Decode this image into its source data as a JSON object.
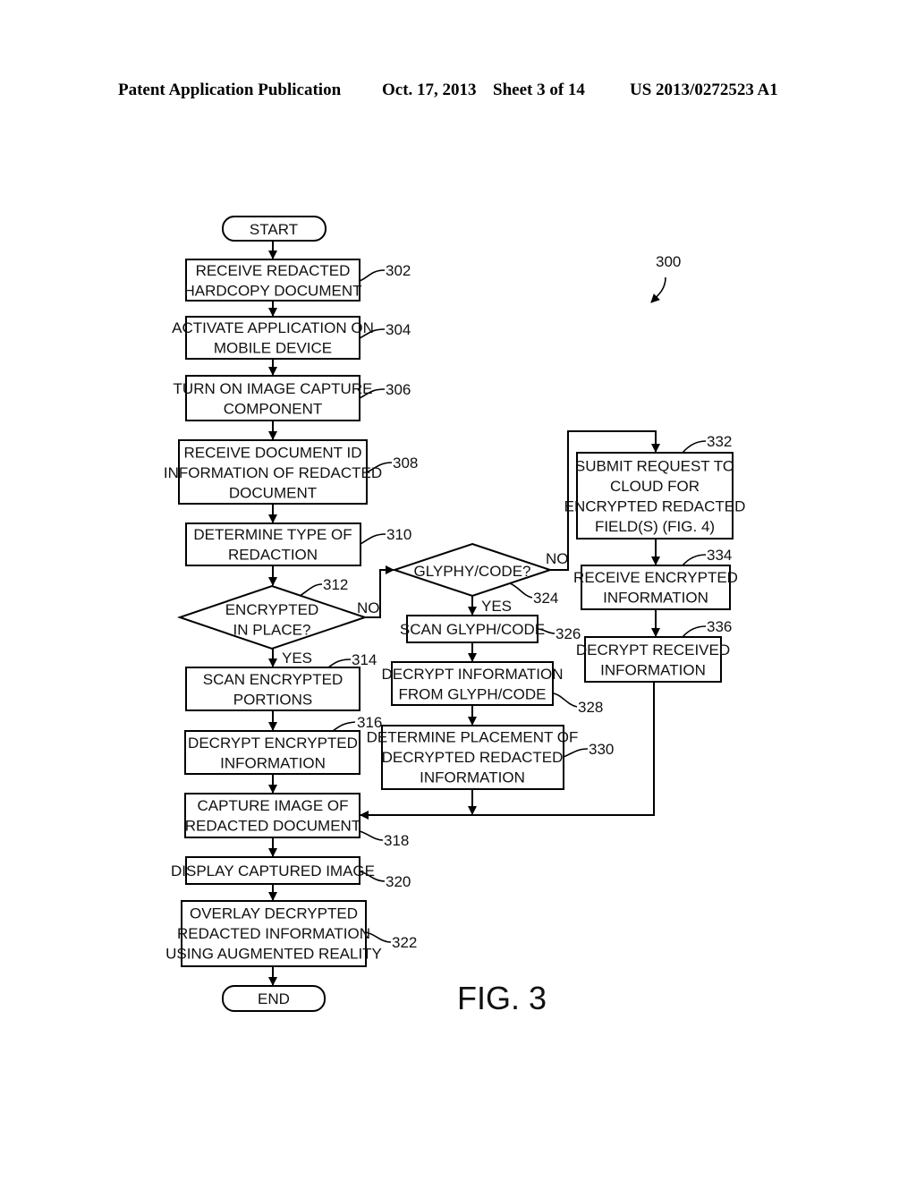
{
  "header": {
    "publication": "Patent Application Publication",
    "date": "Oct. 17, 2013",
    "sheet": "Sheet 3 of 14",
    "number": "US 2013/0272523 A1"
  },
  "figure": {
    "label": "FIG. 3",
    "ref": "300"
  },
  "nodes": {
    "start": {
      "lines": [
        "START"
      ]
    },
    "n302": {
      "ref": "302",
      "lines": [
        "RECEIVE REDACTED",
        "HARDCOPY DOCUMENT"
      ]
    },
    "n304": {
      "ref": "304",
      "lines": [
        "ACTIVATE APPLICATION ON",
        "MOBILE DEVICE"
      ]
    },
    "n306": {
      "ref": "306",
      "lines": [
        "TURN ON IMAGE CAPTURE",
        "COMPONENT"
      ]
    },
    "n308": {
      "ref": "308",
      "lines": [
        "RECEIVE DOCUMENT ID",
        "INFORMATION OF REDACTED",
        "DOCUMENT"
      ]
    },
    "n310": {
      "ref": "310",
      "lines": [
        "DETERMINE TYPE OF",
        "REDACTION"
      ]
    },
    "n312": {
      "ref": "312",
      "lines": [
        "ENCRYPTED",
        "IN PLACE?"
      ],
      "yes": "YES",
      "no": "NO"
    },
    "n314": {
      "ref": "314",
      "lines": [
        "SCAN ENCRYPTED",
        "PORTIONS"
      ]
    },
    "n316": {
      "ref": "316",
      "lines": [
        "DECRYPT ENCRYPTED",
        "INFORMATION"
      ]
    },
    "n318": {
      "ref": "318",
      "lines": [
        "CAPTURE IMAGE OF",
        "REDACTED DOCUMENT"
      ]
    },
    "n320": {
      "ref": "320",
      "lines": [
        "DISPLAY CAPTURED IMAGE"
      ]
    },
    "n322": {
      "ref": "322",
      "lines": [
        "OVERLAY DECRYPTED",
        "REDACTED INFORMATION",
        "USING AUGMENTED REALITY"
      ]
    },
    "end": {
      "lines": [
        "END"
      ]
    },
    "n324": {
      "ref": "324",
      "lines": [
        "GLYPHY/CODE?"
      ],
      "yes": "YES",
      "no": "NO"
    },
    "n326": {
      "ref": "326",
      "lines": [
        "SCAN GLYPH/CODE"
      ]
    },
    "n328": {
      "ref": "328",
      "lines": [
        "DECRYPT INFORMATION",
        "FROM GLYPH/CODE"
      ]
    },
    "n330": {
      "ref": "330",
      "lines": [
        "DETERMINE PLACEMENT OF",
        "DECRYPTED REDACTED",
        "INFORMATION"
      ]
    },
    "n332": {
      "ref": "332",
      "lines": [
        "SUBMIT REQUEST TO",
        "CLOUD FOR",
        "ENCRYPTED REDACTED",
        "FIELD(S) (FIG. 4)"
      ]
    },
    "n334": {
      "ref": "334",
      "lines": [
        "RECEIVE ENCRYPTED",
        "INFORMATION"
      ]
    },
    "n336": {
      "ref": "336",
      "lines": [
        "DECRYPT RECEIVED",
        "INFORMATION"
      ]
    }
  }
}
